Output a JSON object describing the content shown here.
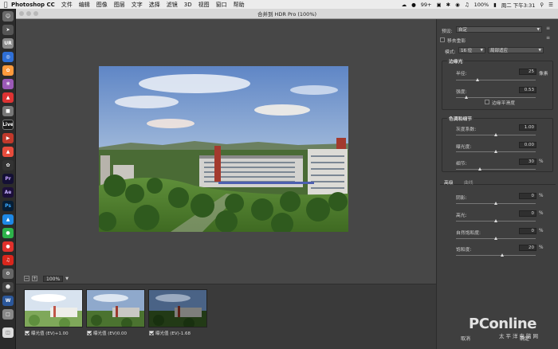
{
  "menubar": {
    "app_name": "Photoshop CC",
    "items": [
      "文件",
      "编辑",
      "图像",
      "图层",
      "文字",
      "选择",
      "滤镜",
      "3D",
      "视图",
      "窗口",
      "帮助"
    ],
    "battery": "100%",
    "badge": "99+",
    "clock": "周二 下午3:31"
  },
  "dock": {
    "labels": [
      "UR",
      "Live",
      "Pr",
      "Ae",
      "Ps"
    ]
  },
  "dialog": {
    "title": "合并到 HDR Pro (100%)"
  },
  "zoom": {
    "value": "100%"
  },
  "thumbnails": [
    {
      "label": "曝光值 (EV)+1.00",
      "checked": true
    },
    {
      "label": "曝光值 (EV)0.00",
      "checked": true
    },
    {
      "label": "曝光值 (EV)-1.68",
      "checked": true
    }
  ],
  "panel": {
    "preset_label": "预设:",
    "preset_value": "自定",
    "remove_ghosts": "移去重影",
    "mode_label": "模式:",
    "mode_value": "16 位",
    "method_value": "局部适应",
    "edge_section": "边缘光",
    "radius_label": "半径:",
    "radius_value": "25",
    "radius_unit": "像素",
    "radius_level": 0.27,
    "strength_label": "强度:",
    "strength_value": "0.53",
    "strength_level": 0.13,
    "edge_smooth": "边缘平滑度",
    "tone_section": "色调和细节",
    "gamma_label": "灰度系数:",
    "gamma_value": "1.00",
    "gamma_level": 0.5,
    "exposure_label": "曝光度:",
    "exposure_value": "0.00",
    "exposure_level": 0.5,
    "detail_label": "细节:",
    "detail_value": "30",
    "detail_unit": "%",
    "detail_level": 0.3,
    "tab_advanced": "高级",
    "tab_curve": "曲线",
    "shadow_label": "阴影:",
    "shadow_value": "0",
    "shadow_level": 0.5,
    "highlight_label": "高光:",
    "highlight_value": "0",
    "highlight_level": 0.5,
    "vibrance_label": "自然饱和度:",
    "vibrance_value": "0",
    "vibrance_level": 0.5,
    "saturation_label": "饱和度:",
    "saturation_value": "20",
    "saturation_level": 0.58,
    "percent": "%",
    "cancel": "取消",
    "ok": "确定"
  },
  "watermark": {
    "brand": "PConline",
    "sub": "太平洋电脑网"
  }
}
